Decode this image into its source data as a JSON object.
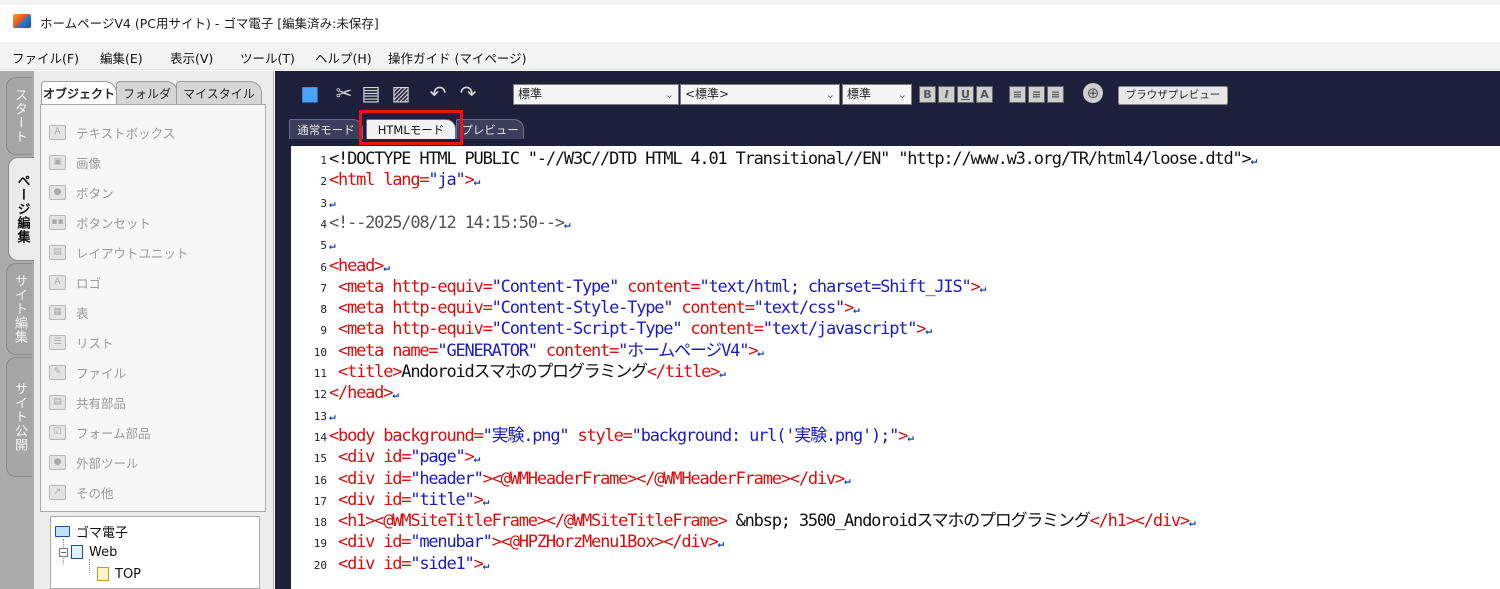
{
  "window": {
    "title": "ホームページV4 (PC用サイト) - ゴマ電子 [編集済み:未保存]"
  },
  "menu": [
    "ファイル(F)",
    "編集(E)",
    "表示(V)",
    "ツール(T)",
    "ヘルプ(H)",
    "操作ガイド (マイページ)"
  ],
  "vertical_tabs": [
    "スタート",
    "ページ編集",
    "サイト編集",
    "サイト公開"
  ],
  "panel_tabs": [
    "オブジェクト",
    "フォルダ",
    "マイスタイル"
  ],
  "objects": [
    "テキストボックス",
    "画像",
    "ボタン",
    "ボタンセット",
    "レイアウトユニット",
    "ロゴ",
    "表",
    "リスト",
    "ファイル",
    "共有部品",
    "フォーム部品",
    "外部ツール",
    "その他"
  ],
  "site_tree": {
    "root": "ゴマ電子",
    "folder": "Web",
    "page": "TOP"
  },
  "toolbar": {
    "style_select": "標準",
    "tag_select": "<標準>",
    "size_select": "標準",
    "format_buttons": [
      "B",
      "I",
      "U",
      "A"
    ],
    "align_buttons": [
      "≡",
      "≡",
      "≡"
    ],
    "preview_button": "ブラウザプレビュー"
  },
  "mode_tabs": [
    "通常モード",
    "HTMLモード",
    "プレビュー"
  ],
  "active_mode": "HTMLモード",
  "code_lines": [
    {
      "n": "1",
      "segs": [
        {
          "c": "t-black",
          "t": "<!DOCTYPE HTML PUBLIC \"-//W3C//DTD HTML 4.01 Transitional//EN\" \"http://www.w3.org/TR/html4/loose.dtd\">"
        }
      ]
    },
    {
      "n": "2",
      "segs": [
        {
          "c": "t-red",
          "t": "<html "
        },
        {
          "c": "t-red",
          "t": "lang="
        },
        {
          "c": "t-blue",
          "t": "\"ja\""
        },
        {
          "c": "t-red",
          "t": ">"
        }
      ]
    },
    {
      "n": "3",
      "segs": []
    },
    {
      "n": "4",
      "segs": [
        {
          "c": "t-gray",
          "t": "<!--2025/08/12 14:15:50-->"
        }
      ]
    },
    {
      "n": "5",
      "segs": []
    },
    {
      "n": "6",
      "segs": [
        {
          "c": "t-red",
          "t": "<head>"
        }
      ]
    },
    {
      "n": "7",
      "segs": [
        {
          "c": "t-red",
          "t": "  <meta http-equiv="
        },
        {
          "c": "t-blue",
          "t": "\"Content-Type\""
        },
        {
          "c": "t-red",
          "t": " content="
        },
        {
          "c": "t-blue",
          "t": "\"text/html; charset=Shift_JIS\""
        },
        {
          "c": "t-red",
          "t": ">"
        }
      ]
    },
    {
      "n": "8",
      "segs": [
        {
          "c": "t-red",
          "t": "  <meta http-equiv="
        },
        {
          "c": "t-blue",
          "t": "\"Content-Style-Type\""
        },
        {
          "c": "t-red",
          "t": " content="
        },
        {
          "c": "t-blue",
          "t": "\"text/css\""
        },
        {
          "c": "t-red",
          "t": ">"
        }
      ]
    },
    {
      "n": "9",
      "segs": [
        {
          "c": "t-red",
          "t": "  <meta http-equiv="
        },
        {
          "c": "t-blue",
          "t": "\"Content-Script-Type\""
        },
        {
          "c": "t-red",
          "t": " content="
        },
        {
          "c": "t-blue",
          "t": "\"text/javascript\""
        },
        {
          "c": "t-red",
          "t": ">"
        }
      ]
    },
    {
      "n": "10",
      "segs": [
        {
          "c": "t-red",
          "t": "  <meta name="
        },
        {
          "c": "t-blue",
          "t": "\"GENERATOR\""
        },
        {
          "c": "t-red",
          "t": " content="
        },
        {
          "c": "t-blue",
          "t": "\"ホームページV4\""
        },
        {
          "c": "t-red",
          "t": ">"
        }
      ]
    },
    {
      "n": "11",
      "segs": [
        {
          "c": "t-red",
          "t": "  <title>"
        },
        {
          "c": "t-black",
          "t": "Andoroidスマホのプログラミング"
        },
        {
          "c": "t-red",
          "t": "</title>"
        }
      ]
    },
    {
      "n": "12",
      "segs": [
        {
          "c": "t-red",
          "t": "</head>"
        }
      ]
    },
    {
      "n": "13",
      "segs": []
    },
    {
      "n": "14",
      "segs": [
        {
          "c": "t-red",
          "t": "<body background="
        },
        {
          "c": "t-blue",
          "t": "\"実験.png\""
        },
        {
          "c": "t-red",
          "t": " style="
        },
        {
          "c": "t-blue",
          "t": "\"background: url('実験.png');\""
        },
        {
          "c": "t-red",
          "t": ">"
        }
      ]
    },
    {
      "n": "15",
      "segs": [
        {
          "c": "t-red",
          "t": "  <div id="
        },
        {
          "c": "t-blue",
          "t": "\"page\""
        },
        {
          "c": "t-red",
          "t": ">"
        }
      ]
    },
    {
      "n": "16",
      "segs": [
        {
          "c": "t-red",
          "t": "  <div id="
        },
        {
          "c": "t-blue",
          "t": "\"header\""
        },
        {
          "c": "t-red",
          "t": "><@WMHeaderFrame></@WMHeaderFrame></div>"
        }
      ]
    },
    {
      "n": "17",
      "segs": [
        {
          "c": "t-red",
          "t": "  <div id="
        },
        {
          "c": "t-blue",
          "t": "\"title\""
        },
        {
          "c": "t-red",
          "t": ">"
        }
      ]
    },
    {
      "n": "18",
      "segs": [
        {
          "c": "t-red",
          "t": "  <h1><@WMSiteTitleFrame></@WMSiteTitleFrame>"
        },
        {
          "c": "t-black",
          "t": " &nbsp; 3500_Andoroidスマホのプログラミング"
        },
        {
          "c": "t-red",
          "t": "</h1></div>"
        }
      ]
    },
    {
      "n": "19",
      "segs": [
        {
          "c": "t-red",
          "t": "  <div id="
        },
        {
          "c": "t-blue",
          "t": "\"menubar\""
        },
        {
          "c": "t-red",
          "t": "><@HPZHorzMenu1Box></div>"
        }
      ]
    },
    {
      "n": "20",
      "segs": [
        {
          "c": "t-red",
          "t": "  <div id="
        },
        {
          "c": "t-blue",
          "t": "\"side1\""
        },
        {
          "c": "t-red",
          "t": ">"
        }
      ]
    }
  ]
}
